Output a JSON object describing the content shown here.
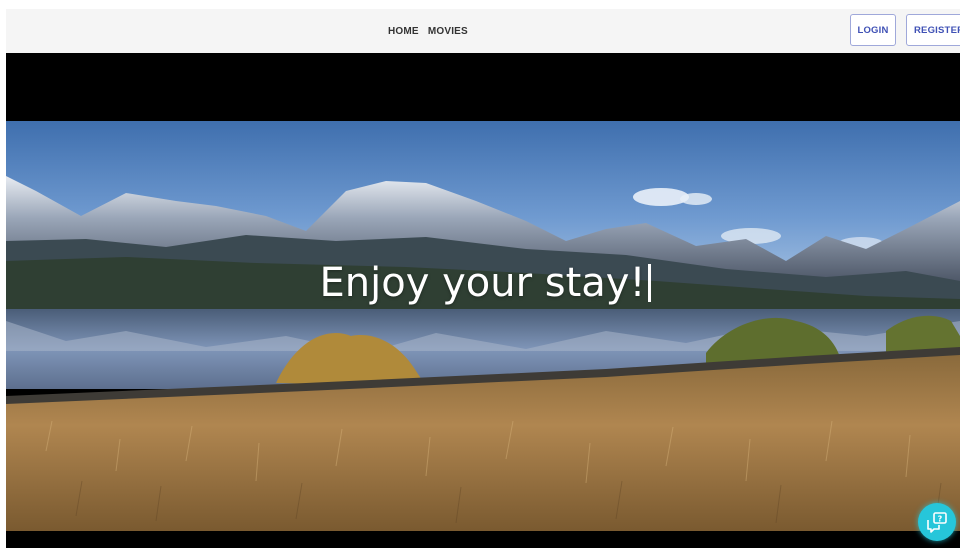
{
  "navbar": {
    "links": [
      {
        "label": "HOME"
      },
      {
        "label": "MOVIES"
      }
    ],
    "login_label": "LOGIN",
    "register_label": "REGISTER"
  },
  "hero": {
    "title": "Enjoy your stay!"
  },
  "help": {
    "icon": "chat-help-icon"
  },
  "colors": {
    "accent": "#3f51b5",
    "help_button": "#26c6da",
    "navbar_bg": "#f5f5f5"
  }
}
